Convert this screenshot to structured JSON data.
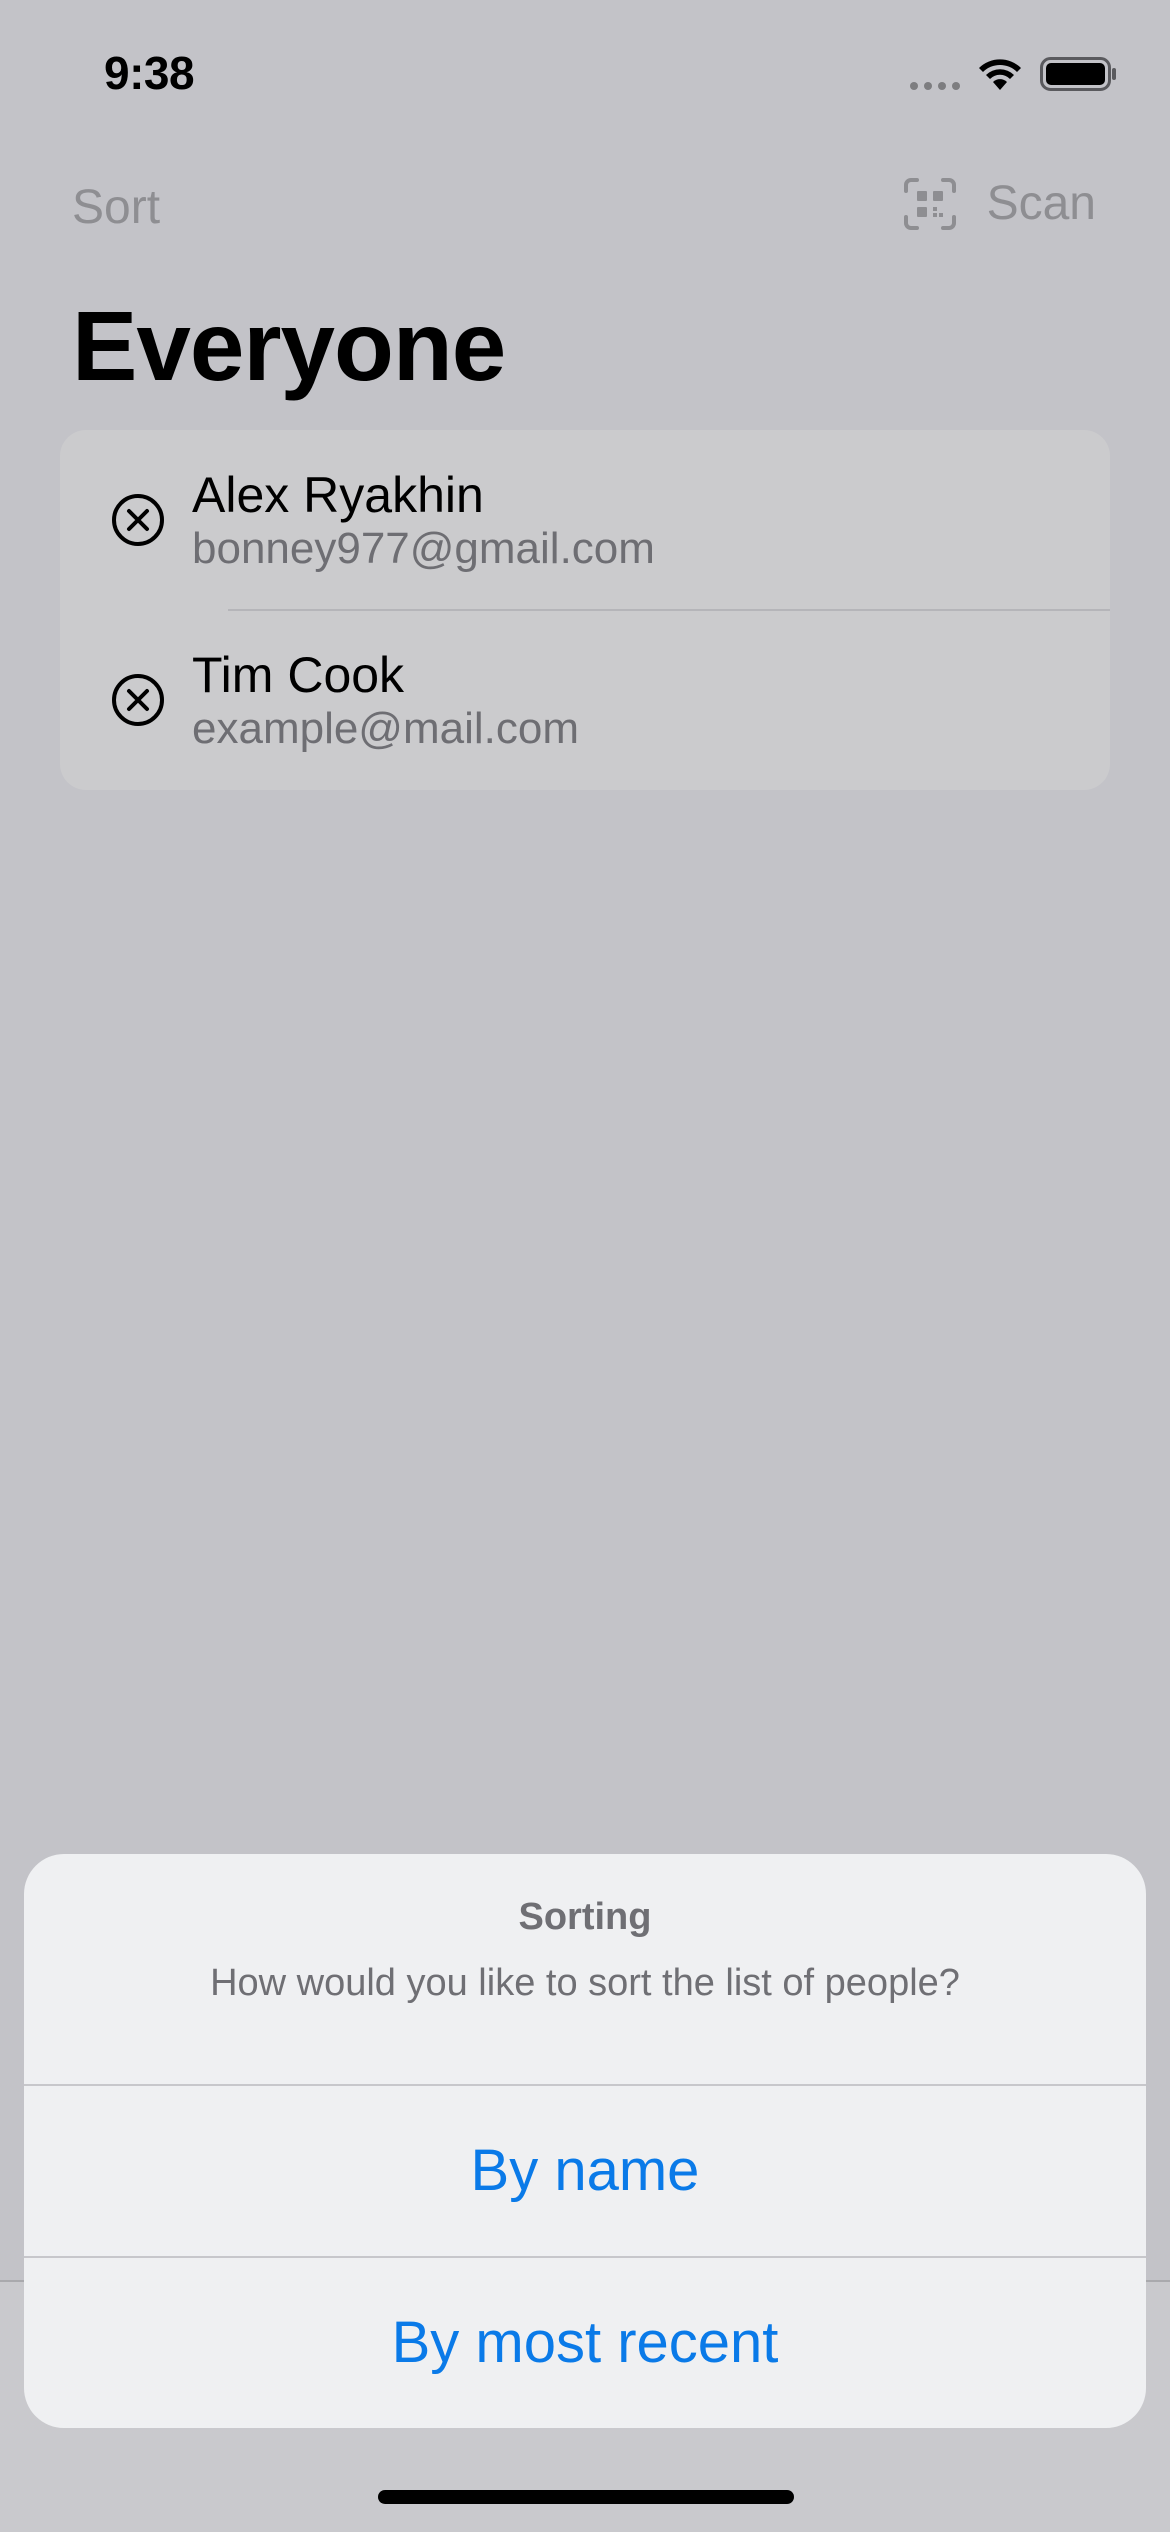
{
  "status_bar": {
    "time": "9:38",
    "icons": [
      "cellular-signal-icon",
      "wifi-icon",
      "battery-icon"
    ]
  },
  "nav": {
    "sort_label": "Sort",
    "scan_label": "Scan",
    "scan_icon": "qr-code-scan-icon"
  },
  "title": "Everyone",
  "people": [
    {
      "name": "Alex Ryakhin",
      "email": "bonney977@gmail.com",
      "icon": "remove-circle-icon"
    },
    {
      "name": "Tim Cook",
      "email": "example@mail.com",
      "icon": "remove-circle-icon"
    }
  ],
  "action_sheet": {
    "title": "Sorting",
    "message": "How would you like to sort the list of people?",
    "options": [
      "By name",
      "By most recent"
    ]
  },
  "colors": {
    "background": "#c3c3c8",
    "accent": "#0a7ae8",
    "sheet": "#eff0f2",
    "list": "#cbcbcd"
  }
}
